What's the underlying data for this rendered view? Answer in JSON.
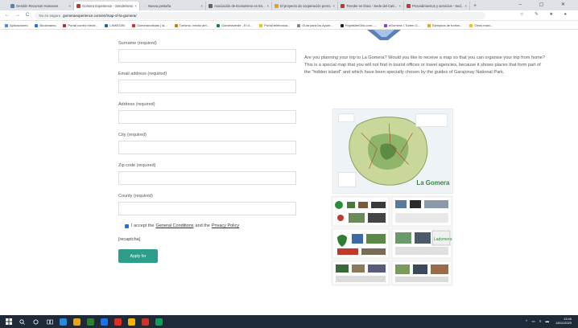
{
  "browser": {
    "tabs": [
      {
        "label": "Gestión Recursos Humanos",
        "color": "#4a86c5"
      },
      {
        "label": "Gomera Experience - Senderismo",
        "color": "#c0392b"
      },
      {
        "label": "Nueva pestaña",
        "color": "#dddddd"
      },
      {
        "label": "Asociación de Ecoturismo en Es...",
        "color": "#5f6368"
      },
      {
        "label": "El proyecto de cooperación permi...",
        "color": "#e8a317"
      },
      {
        "label": "Trender en línea - Sede del Catr...",
        "color": "#c0392b"
      },
      {
        "label": "Procedimientos y servicios - Sed...",
        "color": "#c0392b"
      }
    ],
    "new_tab": "+",
    "window_controls": "– ▢ ✕",
    "back": "←",
    "forward": "→",
    "reload": "C",
    "security": "No es seguro",
    "url": "gomeraexperience.com/en/map-of-la-gomera/",
    "toolbar_icons": "☆ ✎ ★ ●",
    "bookmarks": [
      {
        "label": "Aplicaciones",
        "color": "#4285f4"
      },
      {
        "label": "Bookmarks",
        "color": "#1a73e8"
      },
      {
        "label": "Portal correo electr...",
        "color": "#c5221f"
      },
      {
        "label": "LINKEDIN",
        "color": "#0a66c2"
      },
      {
        "label": "Gomeranoticias | la...",
        "color": "#d93025"
      },
      {
        "label": "Turismo, medio am...",
        "color": "#e37400"
      },
      {
        "label": "Gomeraverde - El d...",
        "color": "#188038"
      },
      {
        "label": "Portal telefonica...",
        "color": "#fbbc04"
      },
      {
        "label": "Guía para los Ayunt...",
        "color": "#80868b"
      },
      {
        "label": "Frightsite/Otis.com -...",
        "color": "#202124"
      },
      {
        "label": "eGomera • Turem G...",
        "color": "#9334e6"
      },
      {
        "label": "Ejemplos de turism...",
        "color": "#e8a317"
      },
      {
        "label": "Otros marc...",
        "color": "#fbbc04"
      }
    ]
  },
  "form": {
    "fields": [
      {
        "label": "Surname (required)",
        "value": ""
      },
      {
        "label": "Email address (required)",
        "value": ""
      },
      {
        "label": "Address (required)",
        "value": ""
      },
      {
        "label": "City (required)",
        "value": ""
      },
      {
        "label": "Zip code (required)",
        "value": ""
      },
      {
        "label": "County (required)",
        "value": ""
      }
    ],
    "consent_prefix": "I accept the",
    "conditions_link": "General Conditions",
    "consent_and": "and the",
    "privacy_link": "Privacy Policy",
    "recaptcha": "[recaptcha]",
    "submit_label": "Apply for"
  },
  "promo": {
    "text": "Are you planning your trip to La Gomera? Would you like to receive a map so that you can organise your trip from home? This is a special map that you will not find in tourist offices or travel agencies, because it shows places that form part of the \"hidden island\" and which have been specially chosen by the guides of Garajonay National Park.",
    "map_logo": "La Gomera",
    "brochure_text": "Ladomera"
  },
  "taskbar": {
    "time": "13:46",
    "date": "18/11/2020",
    "tray_icons": "^ ▭ ◊ ▬"
  }
}
